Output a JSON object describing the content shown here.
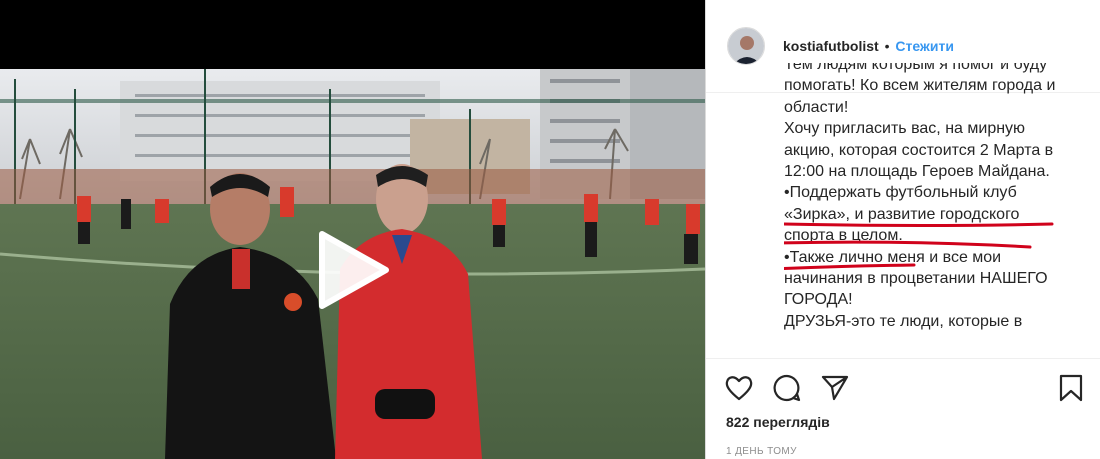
{
  "post": {
    "username": "kostiafutbolist",
    "separator": "•",
    "follow_label": "Стежити",
    "caption_lines": [
      "Тем людям которым я помог и буду",
      "помогать! Ко всем жителям города и",
      "области!",
      "Хочу пригласить вас, на мирную",
      "акцию, которая состоится 2 Марта в",
      "12:00 на площадь Героев Майдана.",
      "•Поддержать футбольный клуб",
      "«Зирка», и развитие городского",
      "спорта в целом.",
      "•Также лично меня и все мои",
      "начинания в процветании НАШЕГО",
      "ГОРОДА!",
      "ДРУЗЬЯ-это те люди, которые в"
    ],
    "views": "822 перегляди",
    "views_suffix": "в",
    "posted": "1 ДЕНЬ ТОМУ"
  },
  "icons": {
    "like": "heart-icon",
    "comment": "comment-icon",
    "share": "share-icon",
    "save": "bookmark-icon",
    "play": "play-icon"
  },
  "colors": {
    "follow": "#3897f0",
    "underline": "#d0021b",
    "text": "#262626",
    "muted": "#8e8e8e"
  }
}
